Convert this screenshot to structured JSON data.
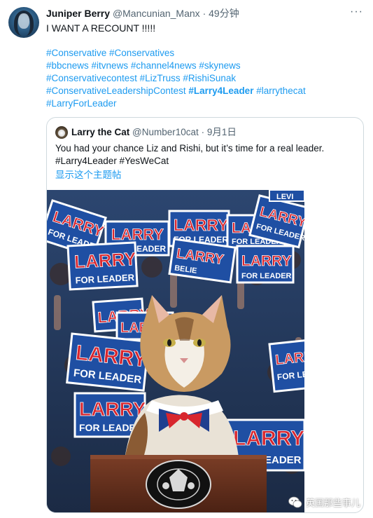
{
  "tweet": {
    "author_name": "Juniper Berry",
    "author_handle": "@Mancunian_Manx",
    "separator": "·",
    "time": "49分钟",
    "more_label": "···",
    "text": "I WANT A RECOUNT !!!!!",
    "hashtag_lines": [
      "#Conservative #Conservatives",
      "#bbcnews #itvnews #channel4news #skynews",
      "#Conservativecontest #LizTruss #RishiSunak",
      "#ConservativeLeadershipContest",
      "#Larry4Leader",
      "#larrythecat",
      "#LarryForLeader"
    ]
  },
  "quote": {
    "author_name": "Larry the Cat",
    "author_handle": "@Number10cat",
    "separator": "·",
    "time": "9月1日",
    "text_line1": "You had your chance Liz and Rishi, but it’s time for a real leader.",
    "text_line2": "#Larry4Leader #YesWeCat",
    "show_thread": "显示这个主题帖"
  },
  "photo": {
    "sign_big": "LARRY",
    "sign_small": "FOR LEADER",
    "sign_partial_1": "BELIE",
    "sign_partial_2": "LEVI"
  },
  "watermark": {
    "text": "英国那些事儿"
  },
  "colors": {
    "link": "#1d9bf0",
    "secondary_text": "#536471",
    "sign_red": "#d8262e",
    "sign_blue": "#1f4fa3"
  }
}
